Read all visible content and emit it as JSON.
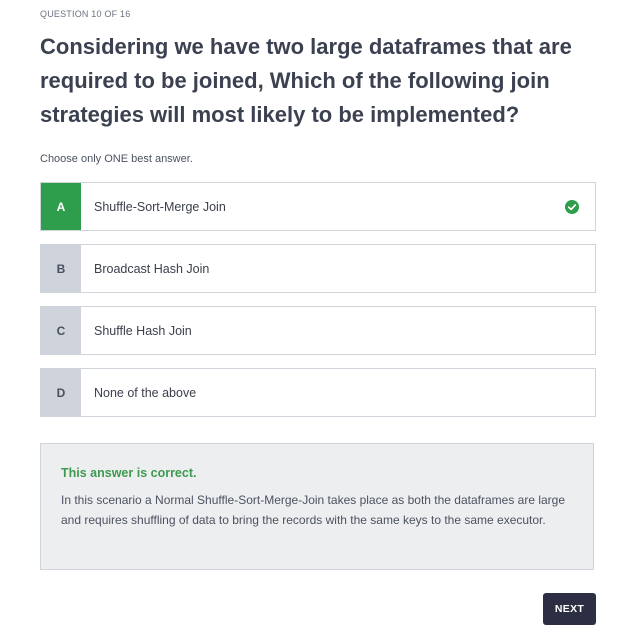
{
  "header": {
    "counter": "QUESTION 10 OF 16"
  },
  "question": {
    "text": "Considering we have two large dataframes that are required to be joined, Which of the following join strategies will most likely to be implemented?",
    "instruction": "Choose only ONE best answer."
  },
  "options": [
    {
      "letter": "A",
      "text": "Shuffle-Sort-Merge Join",
      "selected": true,
      "correct": true
    },
    {
      "letter": "B",
      "text": "Broadcast Hash Join",
      "selected": false,
      "correct": false
    },
    {
      "letter": "C",
      "text": "Shuffle Hash Join",
      "selected": false,
      "correct": false
    },
    {
      "letter": "D",
      "text": "None of the above",
      "selected": false,
      "correct": false
    }
  ],
  "feedback": {
    "title": "This answer is correct.",
    "body": "In this scenario a Normal Shuffle-Sort-Merge-Join takes place as both the dataframes are large and requires shuffling of data to bring the records with the same keys to the same executor."
  },
  "footer": {
    "next_label": "NEXT"
  },
  "icons": {
    "correct_check": "check-circle-icon"
  },
  "colors": {
    "correct_green": "#2f9e4c",
    "feedback_title_green": "#3d9a4f",
    "next_button": "#2c2f43",
    "letter_badge": "#cfd3db"
  }
}
